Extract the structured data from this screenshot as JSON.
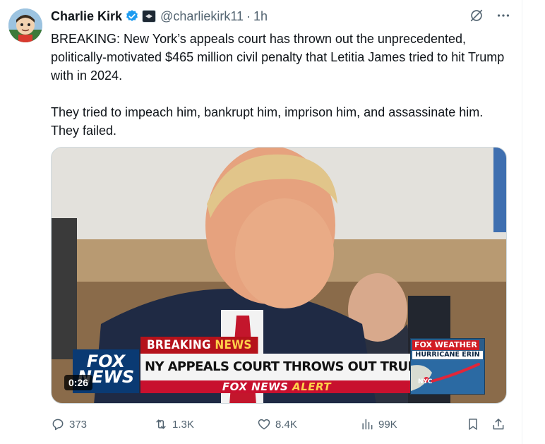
{
  "author": {
    "display_name": "Charlie Kirk",
    "handle": "@charliekirk11",
    "separator": "·",
    "time": "1h",
    "verified_icon": "verified-badge-icon",
    "affiliation_icon": "affiliation-badge-icon"
  },
  "tweet": {
    "paragraphs": [
      "BREAKING: New York’s appeals court has thrown out the unprecedented, politically-motivated $465 million civil penalty that Letitia James tried to hit Trump with in 2024.",
      "They tried to impeach him, bankrupt him, imprison him, and assassinate him. They failed."
    ]
  },
  "video": {
    "duration": "0:26",
    "breaking_label": "BREAKING",
    "breaking_label_accent": "NEWS",
    "headline": "NY APPEALS COURT THROWS OUT TRUMP FRAUD PENALTY",
    "alert_brand": "FOX NEWS",
    "alert_word": "ALERT",
    "fox_logo_line1": "FOX",
    "fox_logo_line2": "NEWS",
    "weather_brand": "FOX WEATHER",
    "weather_storm": "HURRICANE ERIN",
    "weather_city": "NYC"
  },
  "actions": {
    "replies": "373",
    "reposts": "1.3K",
    "likes": "8.4K",
    "views": "99K"
  },
  "colors": {
    "accent": "#1d9bf0",
    "text_primary": "#0f1419",
    "text_secondary": "#536471",
    "breaking_red": "#b5121b",
    "fox_blue": "#0a3a73"
  }
}
